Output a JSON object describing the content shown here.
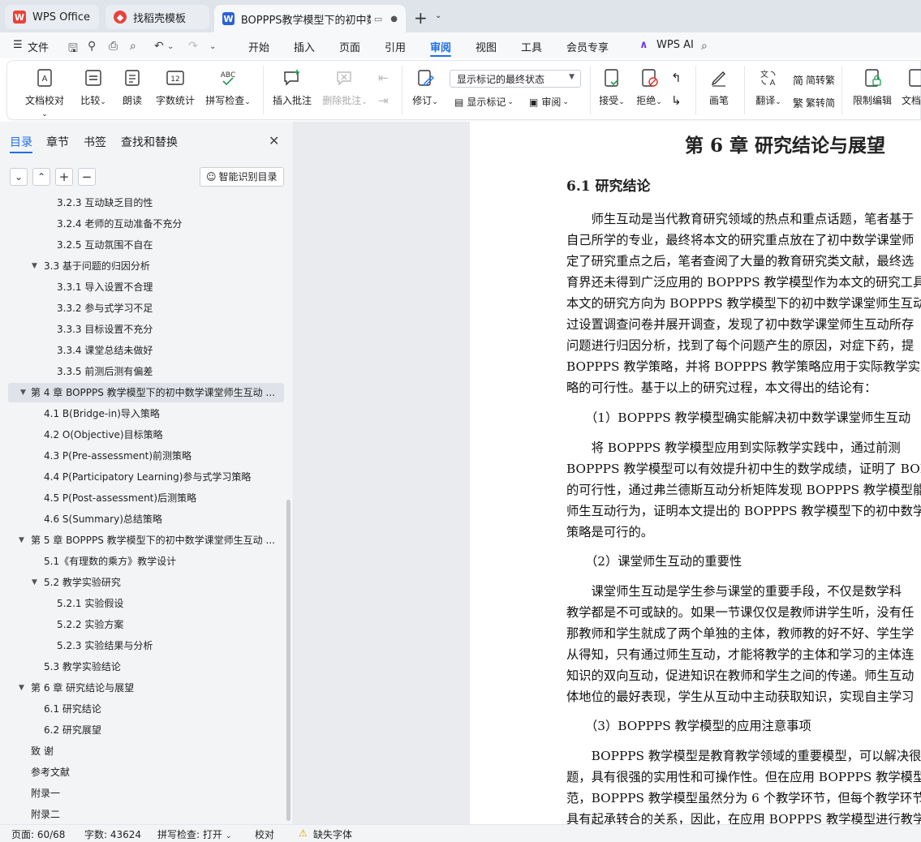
{
  "tabs": [
    {
      "label": "WPS Office",
      "icon": "wps-logo",
      "active": false
    },
    {
      "label": "找稻壳模板",
      "icon": "docer-logo",
      "active": false
    },
    {
      "label": "BOPPPS教学模型下的初中数学",
      "icon": "writer-logo",
      "active": true
    }
  ],
  "menu": {
    "file": "文件",
    "items": [
      "开始",
      "插入",
      "页面",
      "引用",
      "审阅",
      "视图",
      "工具",
      "会员专享"
    ],
    "active": "审阅",
    "ai": "WPS AI"
  },
  "ribbon": {
    "buttons": [
      {
        "label": "文档校对",
        "dropdown": true
      },
      {
        "label": "比较",
        "dropdown": true
      },
      {
        "label": "朗读"
      },
      {
        "label": "字数统计"
      },
      {
        "label": "拼写检查",
        "dropdown": true
      },
      {
        "label": "插入批注"
      },
      {
        "label": "删除批注",
        "dropdown": true
      },
      {
        "label": "修订",
        "dropdown": true
      },
      {
        "label": "接受",
        "dropdown": true
      },
      {
        "label": "拒绝",
        "dropdown": true
      },
      {
        "label": "画笔"
      },
      {
        "label": "翻译",
        "dropdown": true
      },
      {
        "label": "限制编辑"
      },
      {
        "label": "文档权"
      }
    ],
    "markup_select": "显示标记的最终状态",
    "show_markup": "显示标记",
    "review_pane": "审阅",
    "to_traditional": "简转繁",
    "to_simplified": "繁转简"
  },
  "left_panel": {
    "tabs": [
      "目录",
      "章节",
      "书签",
      "查找和替换"
    ],
    "active_tab": "目录",
    "auto_toc": "智能识别目录",
    "toc": [
      {
        "text": "3.2.3 互动缺乏目的性",
        "level": 3
      },
      {
        "text": "3.2.4 老师的互动准备不充分",
        "level": 3
      },
      {
        "text": "3.2.5 互动氛围不自在",
        "level": 3
      },
      {
        "text": "3.3 基于问题的归因分析",
        "level": 2,
        "expanded": true
      },
      {
        "text": "3.3.1 导入设置不合理",
        "level": 3
      },
      {
        "text": "3.3.2 参与式学习不足",
        "level": 3
      },
      {
        "text": "3.3.3 目标设置不充分",
        "level": 3
      },
      {
        "text": "3.3.4 课堂总结未做好",
        "level": 3
      },
      {
        "text": "3.3.5 前测后测有偏差",
        "level": 3
      },
      {
        "text": "第 4 章  BOPPPS 教学模型下的初中数学课堂师生互动 ...",
        "level": 1,
        "expanded": true,
        "selected": true
      },
      {
        "text": "4.1 B(Bridge-in)导入策略",
        "level": 2
      },
      {
        "text": "4.2 O(Objective)目标策略",
        "level": 2
      },
      {
        "text": "4.3 P(Pre-assessment)前测策略",
        "level": 2
      },
      {
        "text": "4.4 P(Participatory Learning)参与式学习策略",
        "level": 2
      },
      {
        "text": "4.5 P(Post-assessment)后测策略",
        "level": 2
      },
      {
        "text": "4.6 S(Summary)总结策略",
        "level": 2
      },
      {
        "text": "第 5 章  BOPPPS 教学模型下的初中数学课堂师生互动 ...",
        "level": 1,
        "expanded": true
      },
      {
        "text": "5.1《有理数的乘方》教学设计",
        "level": 2
      },
      {
        "text": "5.2 教学实验研究",
        "level": 2,
        "expanded": true
      },
      {
        "text": "5.2.1 实验假设",
        "level": 3
      },
      {
        "text": "5.2.2 实验方案",
        "level": 3
      },
      {
        "text": "5.2.3 实验结果与分析",
        "level": 3
      },
      {
        "text": "5.3 教学实验结论",
        "level": 2
      },
      {
        "text": "第 6 章  研究结论与展望",
        "level": 1,
        "expanded": true
      },
      {
        "text": "6.1 研究结论",
        "level": 2
      },
      {
        "text": "6.2 研究展望",
        "level": 2
      },
      {
        "text": "致  谢",
        "level": 1
      },
      {
        "text": "参考文献",
        "level": 1
      },
      {
        "text": "附录一",
        "level": 1
      },
      {
        "text": "附录二",
        "level": 1
      }
    ]
  },
  "document": {
    "chapter_title": "第 6 章  研究结论与展望",
    "section_title": "6.1 研究结论",
    "lines": [
      "　　师生互动是当代教育研究领域的热点和重点话题，笔者基于",
      "自己所学的专业，最终将本文的研究重点放在了初中数学课堂师",
      "定了研究重点之后，笔者查阅了大量的教育研究类文献，最终选",
      "育界还未得到广泛应用的 BOPPPS 教学模型作为本文的研究工具",
      "本文的研究方向为 BOPPPS 教学模型下的初中数学课堂师生互动",
      "过设置调查问卷并展开调查，发现了初中数学课堂师生互动所存",
      "问题进行归因分析，找到了每个问题产生的原因，对症下药，提",
      "BOPPPS 教学策略，并将 BOPPPS 教学策略应用于实际教学实践",
      "略的可行性。基于以上的研究过程，本文得出的结论有：",
      "　　（1）BOPPPS 教学模型确实能解决初中数学课堂师生互动",
      "　　将 BOPPPS 教学模型应用到实际教学实践中，通过前测",
      "BOPPPS 教学模型可以有效提升初中生的数学成绩，证明了 BOP",
      "的可行性，通过弗兰德斯互动分析矩阵发现 BOPPPS 教学模型能",
      "师生互动行为，证明本文提出的 BOPPPS 教学模型下的初中数学",
      "策略是可行的。",
      "　　（2）课堂师生互动的重要性",
      "　　课堂师生互动是学生参与课堂的重要手段，不仅是数学科",
      "教学都是不可或缺的。如果一节课仅仅是教师讲学生听，没有任",
      "那教师和学生就成了两个单独的主体，教师教的好不好、学生学",
      "从得知，只有通过师生互动，才能将教学的主体和学习的主体连",
      "知识的双向互动，促进知识在教师和学生之间的传递。师生互动",
      "体地位的最好表现，学生从互动中主动获取知识，实现自主学习",
      "　　（3）BOPPPS 教学模型的应用注意事项",
      "　　BOPPPS 教学模型是教育教学领域的重要模型，可以解决很",
      "题，具有很强的实用性和可操作性。但在应用 BOPPPS 教学模型",
      "范，BOPPPS 教学模型虽然分为 6 个教学环节，但每个教学环节",
      "具有起承转合的关系，因此，在应用 BOPPPS 教学模型进行教学"
    ]
  },
  "status": {
    "page": "页面: 60/68",
    "words": "字数: 43624",
    "spell": "拼写检查: 打开",
    "proof": "校对",
    "missing_font": "缺失字体"
  },
  "colors": {
    "accent": "#1f6feb",
    "wps_red": "#e8423b",
    "writer_blue": "#2b62d9"
  }
}
